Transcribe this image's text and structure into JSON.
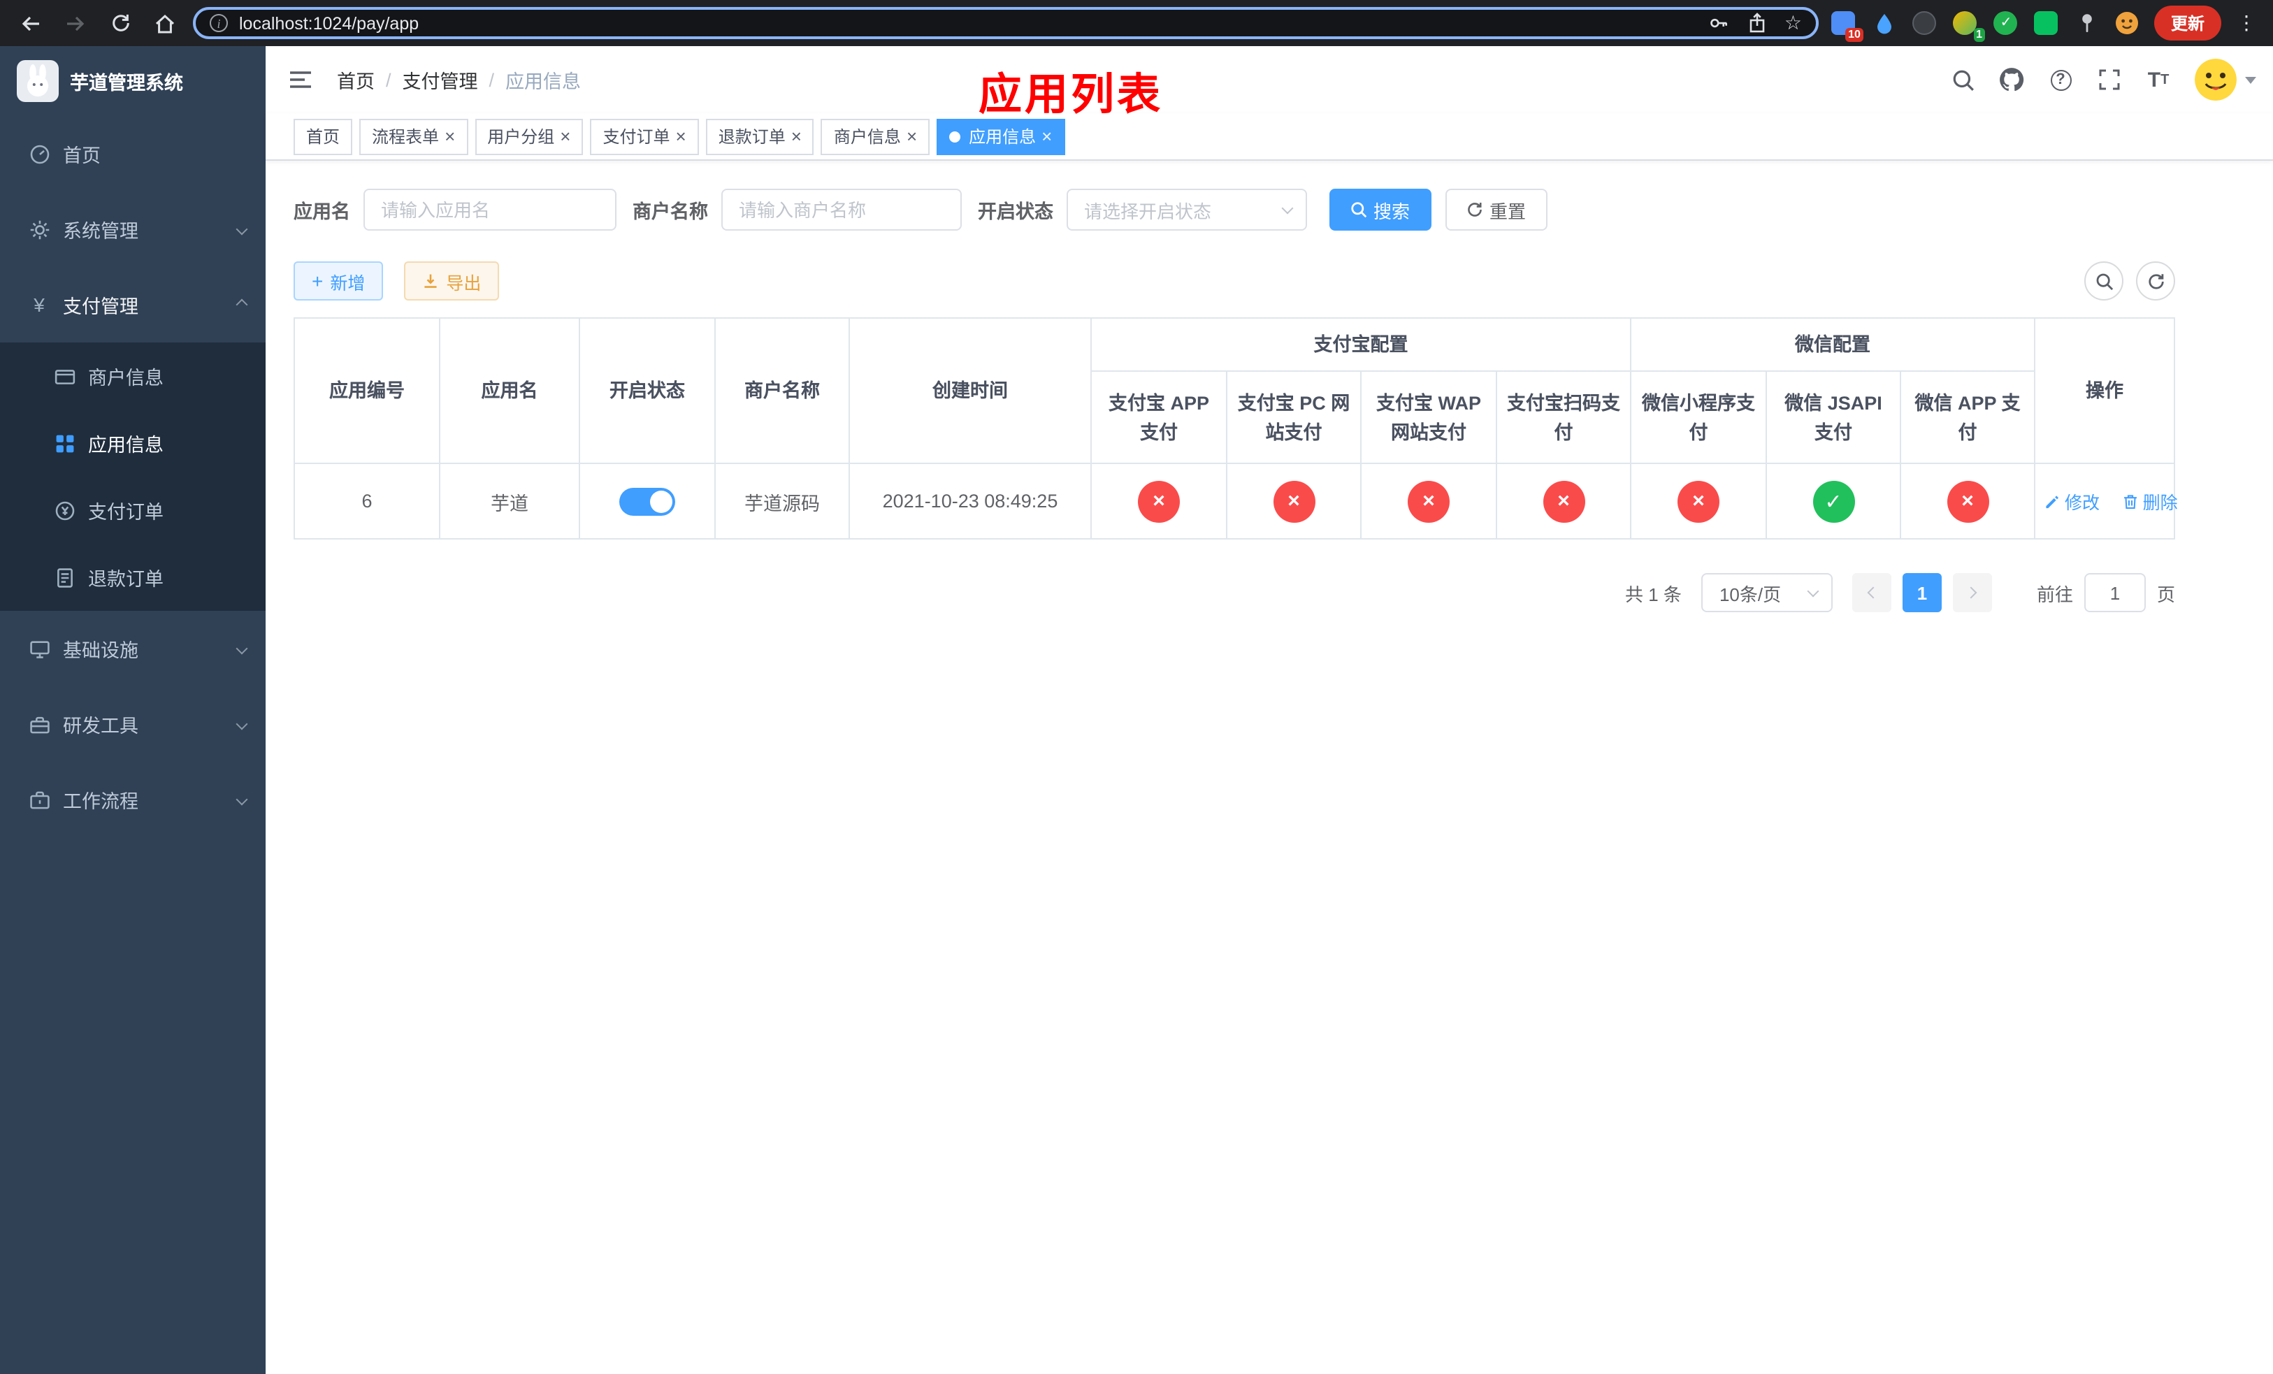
{
  "browser": {
    "url": "localhost:1024/pay/app",
    "update_button": "更新",
    "badges": {
      "ext1": "10",
      "ext4": "1"
    }
  },
  "sidebar": {
    "app_title": "芋道管理系统",
    "items": {
      "home": "首页",
      "system": "系统管理",
      "payment": "支付管理",
      "merchant": "商户信息",
      "app_info": "应用信息",
      "pay_order": "支付订单",
      "refund_order": "退款订单",
      "infra": "基础设施",
      "dev_tools": "研发工具",
      "workflow": "工作流程"
    }
  },
  "header": {
    "breadcrumb": [
      "首页",
      "支付管理",
      "应用信息"
    ],
    "separator": "/"
  },
  "annotation": {
    "page_title": "应用列表"
  },
  "tabs": [
    "首页",
    "流程表单",
    "用户分组",
    "支付订单",
    "退款订单",
    "商户信息",
    "应用信息"
  ],
  "filters": {
    "app_name_label": "应用名",
    "app_name_placeholder": "请输入应用名",
    "merchant_label": "商户名称",
    "merchant_placeholder": "请输入商户名称",
    "status_label": "开启状态",
    "status_placeholder": "请选择开启状态",
    "search": "搜索",
    "reset": "重置"
  },
  "toolbar": {
    "add": "新增",
    "export": "导出"
  },
  "table": {
    "groups": {
      "alipay": "支付宝配置",
      "wechat": "微信配置"
    },
    "columns": {
      "id": "应用编号",
      "name": "应用名",
      "status": "开启状态",
      "merchant": "商户名称",
      "created": "创建时间",
      "alipay_app": "支付宝 APP 支付",
      "alipay_pc": "支付宝 PC 网站支付",
      "alipay_wap": "支付宝 WAP 网站支付",
      "alipay_qr": "支付宝扫码支付",
      "wx_mini": "微信小程序支付",
      "wx_jsapi": "微信 JSAPI 支付",
      "wx_app": "微信 APP 支付",
      "actions": "操作"
    },
    "row": {
      "id": "6",
      "name": "芋道",
      "status": "on",
      "merchant": "芋道源码",
      "created": "2021-10-23 08:49:25",
      "configs": [
        {
          "state": "no",
          "glyph": "×"
        },
        {
          "state": "no",
          "glyph": "×"
        },
        {
          "state": "no",
          "glyph": "×"
        },
        {
          "state": "no",
          "glyph": "×"
        },
        {
          "state": "no",
          "glyph": "×"
        },
        {
          "state": "yes",
          "glyph": "✓"
        },
        {
          "state": "no",
          "glyph": "×"
        }
      ],
      "edit": "修改",
      "delete": "删除"
    }
  },
  "pagination": {
    "total": "共 1 条",
    "page_size": "10条/页",
    "page": "1",
    "goto_label": "前往",
    "goto_value": "1",
    "page_unit": "页"
  },
  "icons": {
    "close": "×",
    "check": "✓",
    "cross": "×",
    "plus": "+",
    "yen": "¥",
    "star": "☆",
    "kebab": "⋮"
  },
  "colors": {
    "accent": "#409eff",
    "success": "#22c05c",
    "danger": "#fa4b4b",
    "warning": "#e6a23c",
    "sidebar_bg": "#304156",
    "sidebar_submenu_bg": "#1f2d3d",
    "active_tab_bg": "#409eff",
    "annotation_red": "#fe0000",
    "chrome_bg": "#202124",
    "url_focus_ring": "#8ab4f8"
  }
}
